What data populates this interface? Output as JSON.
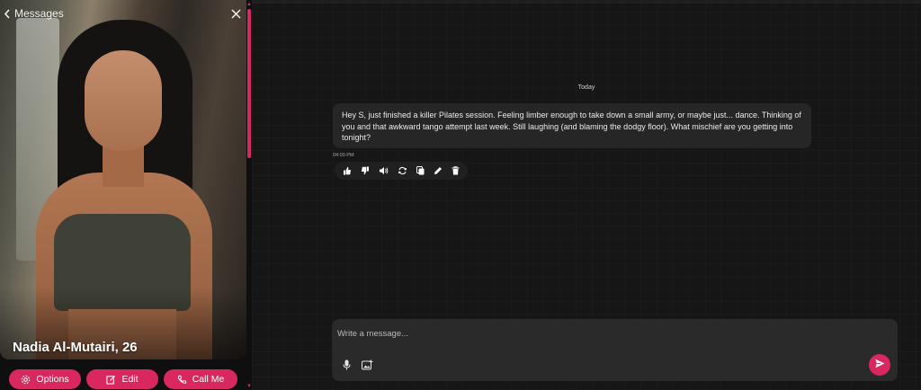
{
  "header": {
    "back_label": "Messages"
  },
  "profile": {
    "name_label": "Nadia Al-Mutairi, 26"
  },
  "actions": {
    "options_label": "Options",
    "edit_label": "Edit",
    "call_label": "Call Me"
  },
  "chat": {
    "date_separator": "Today",
    "message": {
      "text": "Hey S, just finished a killer Pilates session. Feeling limber enough to take down a small army, or maybe just... dance. Thinking of you and that awkward tango attempt last week. Still laughing (and blaming the dodgy floor). What mischief are you getting into tonight?",
      "time": "04:00 PM"
    },
    "message_tools": [
      "thumbs-up-icon",
      "thumbs-down-icon",
      "speaker-icon",
      "regenerate-icon",
      "copy-icon",
      "edit-pencil-icon",
      "trash-icon"
    ]
  },
  "composer": {
    "placeholder": "Write a message..."
  },
  "colors": {
    "accent": "#d8285f",
    "background": "#161616",
    "bubble": "#262626",
    "composer": "#2a2a2a"
  }
}
